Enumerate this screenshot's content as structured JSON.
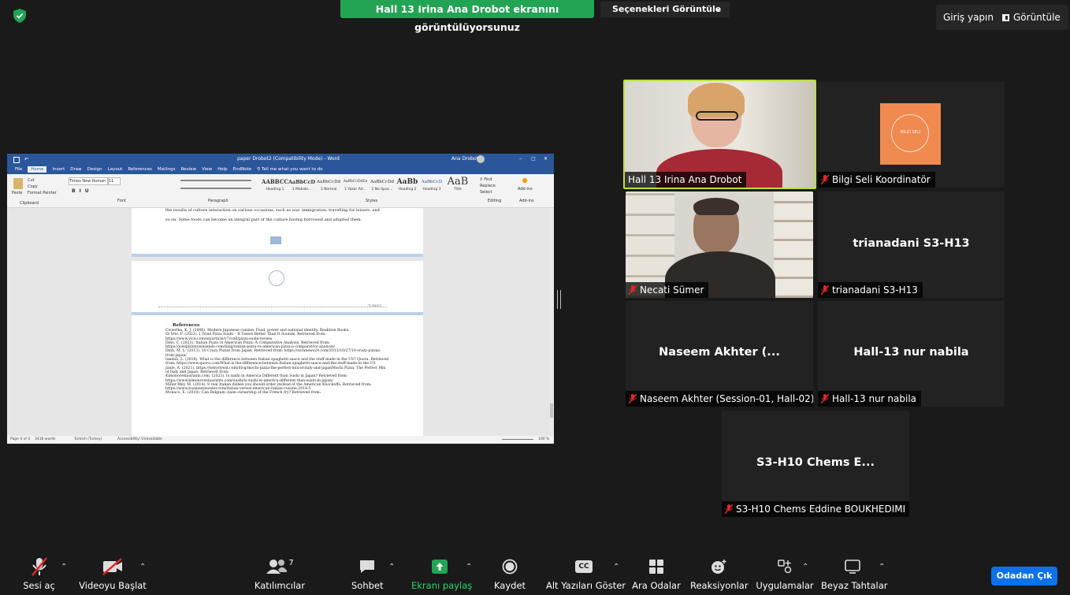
{
  "top_bar": {
    "share_banner": "Hall 13 Irina Ana Drobot ekranını görüntülüyorsunuz",
    "view_options": "Seçenekleri Görüntüle",
    "sign_in": "Giriş yapın",
    "view": "Görüntüle"
  },
  "shared_screen": {
    "title": "paper Drobot2 (Compatibility Mode) - Word",
    "user": "Ana Drobot",
    "tabs": [
      "File",
      "Home",
      "Insert",
      "Draw",
      "Design",
      "Layout",
      "References",
      "Mailings",
      "Review",
      "View",
      "Help",
      "EndNote"
    ],
    "tell_me": "Tell me what you want to do",
    "ribbon": {
      "paste": "Paste",
      "cut": "Cut",
      "copy": "Copy",
      "format_painter": "Format Painter",
      "clipboard": "Clipboard",
      "font_name": "Times New Roman",
      "font_size": "11",
      "font_group": "Font",
      "paragraph_group": "Paragraph",
      "styles_group": "Styles",
      "editing_group": "Editing",
      "addins_group": "Add-ins",
      "find": "Find",
      "replace": "Replace",
      "select": "Select",
      "addins": "Add-ins",
      "styles": [
        {
          "preview": "AABBCC",
          "name": "Heading 1"
        },
        {
          "preview": "AaBbCcD",
          "name": "1 Makale..."
        },
        {
          "preview": "AaBbCcDd",
          "name": "1 Normal"
        },
        {
          "preview": "AaBbCcDdEe",
          "name": "1 Yazar Ad..."
        },
        {
          "preview": "AaBbCcDd",
          "name": "1 No Spac..."
        },
        {
          "preview": "AaBb",
          "name": "Heading 2"
        },
        {
          "preview": "AaBbCcD",
          "name": "Heading 3"
        },
        {
          "preview": "AaB",
          "name": "Title"
        }
      ]
    },
    "page1_lines": [
      "the results of culture interaction on various occasions, such as war, immigration, travelling for leisure, and",
      "so on. Some foods can become an integral part of the culture having borrowed and adapted them."
    ],
    "footer_right": "TURKEY",
    "references_heading": "References",
    "references": [
      "Cwiertka, K. J. (2006). Modern Japanese cuisine: Food, power and national identity. Reaktion Books.",
      "Di Vito, F. (2022). I Tried Pizza Sushi – It Tastes Better Than It Sounds. Retrieved from: https://www.vice.com/en/article/v7vvz8/pizza-sushi-review",
      "Dino, C. (2023). Italian Pizza vs American Pizza: A Comparative Analysis. Retrieved from: https://joespizzatownsends.com/blog/italian-pizza-vs-american-pizza-a-comparative-analysis/",
      "Dinh, M. L. (2013). 10 Crazy Pizzas from Japan. Retrieved from: https://soranews24.com/2013/10/27/10-crazy-pizzas-from-japan/",
      "Iandoli, L. (2018). What is the difference between Italian spaghetti sauce and the stuff made in the US? Quora. Retrieved from: https://www.quora.com/What-is-the-difference-between-Italian-spaghetti-sauce-and-the-stuff-made-in-the-US",
      "Janie, A. (2021). https://tokyotreat.com/blog/mochi-pizza-the-perfect-mix-of-italy-and-japanMochi Pizza: The Perfect Mix of Italy and Japan. Retrieved from:",
      "Kimonorestaurants.com. (2023). Is sushi in America Different than Sushi in Japan? Retrieved from: https://www.kimonorestaurants.com/sushi/is-sushi-in-america-different-than-sushi-in-japan/",
      "Miller-Wey, M. (2014). 8 real Italian dishes you should order instead of the American Knockoffs. Retrieved from: https://www.businessinsider.com/italian-versus-american-italian-cuisine-2014-5",
      "Monaco, E. (2018). Can Belgium claim ownership of the French fry? Retrieved from:"
    ],
    "status": {
      "page": "Page 4 of 4",
      "words": "3416 words",
      "language": "Turkish (Turkey)",
      "accessibility": "Accessibility: Unavailable",
      "zoom": "100 %"
    }
  },
  "participants": [
    {
      "id": "irina",
      "name": "Hall 13 Irina Ana Drobot",
      "muted": false,
      "video": true,
      "active_speaker": true
    },
    {
      "id": "bilgi",
      "name": "Bilgi Seli Koordinatör",
      "muted": true,
      "video": false,
      "logo_text": "BİLGİ SELİ"
    },
    {
      "id": "necati",
      "name": "Necati Sümer",
      "muted": true,
      "video": true
    },
    {
      "id": "triana",
      "name": "trianadani S3-H13",
      "muted": true,
      "video": false,
      "center_text": "trianadani S3-H13"
    },
    {
      "id": "naseem",
      "name": "Naseem Akhter (Session-01, Hall-02)",
      "muted": true,
      "video": false,
      "center_text": "Naseem Akhter (..."
    },
    {
      "id": "nabila",
      "name": "Hall-13 nur nabila",
      "muted": true,
      "video": false,
      "center_text": "Hall-13 nur nabila"
    },
    {
      "id": "chems",
      "name": "S3-H10 Chems Eddine BOUKHEDIMI",
      "muted": true,
      "video": false,
      "center_text": "S3-H10 Chems E..."
    }
  ],
  "toolbar": {
    "unmute": "Sesi aç",
    "start_video": "Videoyu Başlat",
    "participants": "Katılımcılar",
    "participant_count": "7",
    "chat": "Sohbet",
    "share_screen": "Ekranı paylaş",
    "record": "Kaydet",
    "captions": "Alt Yazıları Göster",
    "captions_badge": "CC",
    "breakout": "Ara Odalar",
    "reactions": "Reaksiyonlar",
    "apps": "Uygulamalar",
    "whiteboards": "Beyaz Tahtalar",
    "leave": "Odadan Çık"
  },
  "colors": {
    "share_green": "#23a455",
    "active_speaker": "#b6e23a",
    "leave_blue": "#0e71eb",
    "muted_red": "#e02828",
    "word_blue": "#2b579a"
  }
}
